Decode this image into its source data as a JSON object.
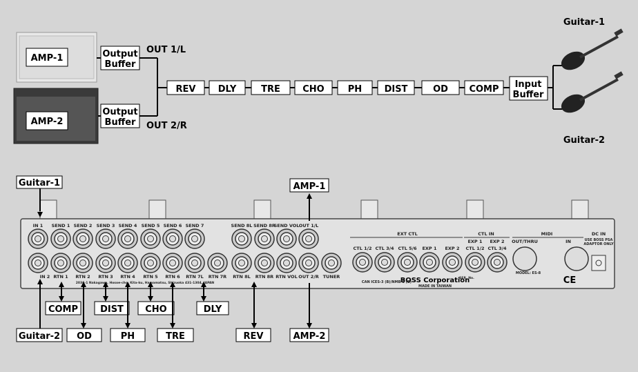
{
  "top": {
    "amps": [
      "AMP-1",
      "AMP-2"
    ],
    "output_buffer": [
      "Output",
      "Buffer"
    ],
    "outs": [
      "OUT 1/L",
      "OUT 2/R"
    ],
    "chain": [
      "REV",
      "DLY",
      "TRE",
      "CHO",
      "PH",
      "DIST",
      "OD",
      "COMP"
    ],
    "input_buffer": [
      "Input",
      "Buffer"
    ],
    "guitars": [
      "Guitar-1",
      "Guitar-2"
    ]
  },
  "panel": {
    "top_row": [
      "IN 1",
      "SEND 1",
      "SEND 2",
      "SEND 3",
      "SEND 4",
      "SEND 5",
      "SEND 6",
      "SEND 7",
      "",
      "SEND 8L",
      "SEND 8R",
      "SEND VOL",
      "OUT 1/L",
      ""
    ],
    "bottom_row": [
      "IN 2",
      "RTN 1",
      "RTN 2",
      "RTN 3",
      "RTN 4",
      "RTN 5",
      "RTN 6",
      "RTN 7L",
      "RTN 7R",
      "RTN 8L",
      "RTN 8R",
      "RTN VOL",
      "OUT 2/R",
      "TUNER"
    ],
    "ext_ctl_header": "EXT CTL",
    "ctl_in_header": "CTL IN",
    "midi_header": "MIDI",
    "dc_in": "DC IN",
    "adaptor_note": [
      "USE BOSS PSA",
      "ADAPTOR ONLY"
    ],
    "ctl_jacks": [
      "CTL 1/2",
      "CTL 3/4",
      "CTL 5/6",
      "EXP 1",
      "EXP 2",
      "CTL 1/2",
      "CTL 3/4"
    ],
    "ctl_in_sub": [
      "EXP 1",
      "EXP 2"
    ],
    "midi_ports": [
      "OUT/THRU",
      "IN"
    ],
    "brand": "BOSS Corporation",
    "made_in": "MADE IN TAIWAN",
    "model": "MODEL: ES-8",
    "ser": "SER. No.",
    "compliance": "CAN ICES-3 (B)/NMB-3 (B)",
    "address": "2036-1 Nakagawa, Hosoe-cho, Kita-ku, Hamamatsu, Shizuoka 431-1304, JAPAN"
  },
  "connections": {
    "guitar1": "Guitar-1",
    "amp1": "AMP-1",
    "guitar2": "Guitar-2",
    "amp2": "AMP-2",
    "returns": [
      "COMP",
      "DIST",
      "CHO",
      "DLY"
    ],
    "sends": [
      "OD",
      "PH",
      "TRE",
      "REV"
    ]
  }
}
